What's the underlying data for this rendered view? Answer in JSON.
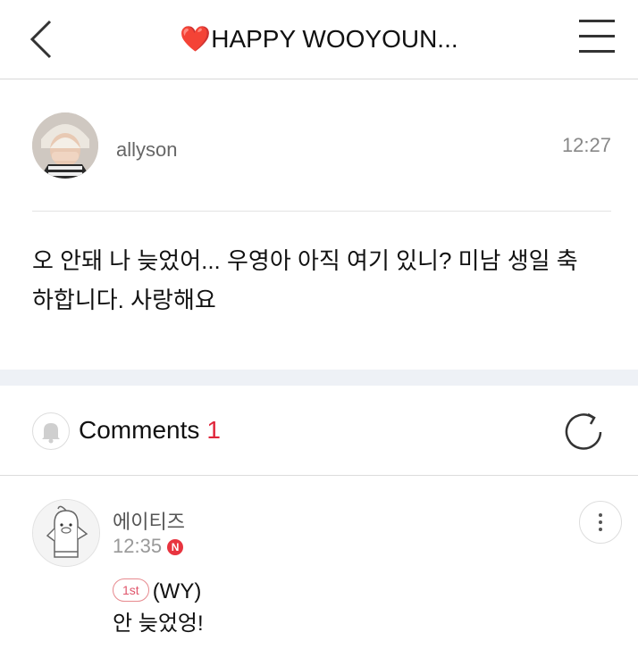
{
  "header": {
    "title_heart": "❤️",
    "title_text": "HAPPY WOOYOUN..."
  },
  "post": {
    "author": "allyson",
    "time": "12:27",
    "body_line1": "오 안돼 나 늦었어... 우영아 아직 여기 있니? 미남 생일 축",
    "body_line2": "하합니다. 사랑해요"
  },
  "comments": {
    "label": "Comments",
    "count": "1",
    "items": [
      {
        "author": "에이티즈",
        "time": "12:35",
        "new_badge": "N",
        "rank": "1st",
        "line1": "(WY)",
        "line2": "안 늦었엉!"
      }
    ]
  },
  "colors": {
    "accent": "#e0263b",
    "band": "#eef1f6"
  }
}
